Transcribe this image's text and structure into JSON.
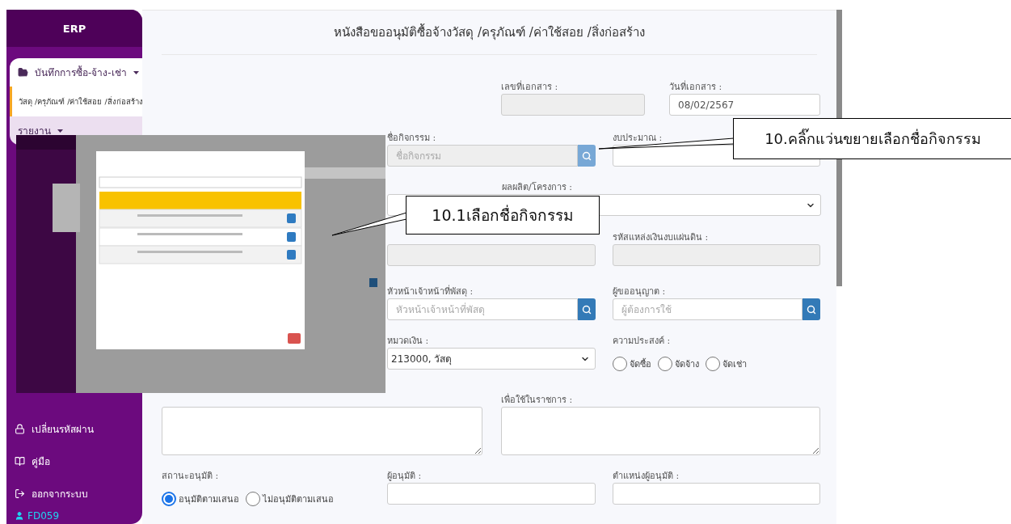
{
  "sidebar": {
    "brand": "ERP",
    "menu": [
      {
        "kind": "group",
        "label": "บันทึกการซื้อ-จ้าง-เช่า",
        "expanded": true
      },
      {
        "kind": "link",
        "label": "วัสดุ /ครุภัณฑ์ /ค่าใช้สอย /สิ่งก่อสร้าง",
        "selected": true
      },
      {
        "kind": "group",
        "label": "รายงาน",
        "expanded": false
      }
    ],
    "links": [
      {
        "label": "เปลี่ยนรหัสผ่าน"
      },
      {
        "label": "คู่มือ"
      },
      {
        "label": "ออกจากระบบ"
      }
    ],
    "user": "FD059"
  },
  "form": {
    "title": "หนังสือขออนุมัติซื้อจ้างวัสดุ /ครุภัณฑ์ /ค่าใช้สอย /สิ่งก่อสร้าง",
    "rows": [
      {
        "fields": [
          {
            "kind": "text",
            "label": "เลขที่เอกสาร :",
            "disabled": true
          },
          {
            "kind": "text",
            "label": "วันที่เอกสาร :",
            "value": "08/02/2567",
            "disabled": false
          }
        ]
      },
      {
        "fields": [
          {
            "kind": "search",
            "label": "ชื่อกิจกรรม :",
            "placeholder": "ชื่อกิจกรรม",
            "disabled": true
          },
          {
            "kind": "text",
            "label": "งบประมาณ :",
            "disabled": false
          }
        ]
      },
      {
        "fields": [
          {
            "kind": "select",
            "label": "ผลผลิต/โครงการ :"
          }
        ]
      },
      {
        "fields": [
          {
            "kind": "text",
            "disabled": true
          },
          {
            "kind": "text",
            "label": "รหัสแหล่งเงินงบแผ่นดิน :",
            "disabled": true
          }
        ]
      },
      {
        "fields": [
          {
            "kind": "search",
            "label": "หัวหน้าเจ้าหน้าที่พัสดุ :",
            "placeholder": "หัวหน้าเจ้าหน้าที่พัสดุ",
            "disabled": false
          },
          {
            "kind": "search",
            "label": "ผู้ขออนุญาต :",
            "placeholder": "ผู้ต้องการใช้",
            "disabled": false
          }
        ]
      },
      {
        "fields": [
          {
            "kind": "select",
            "label": "หมวดเงิน :",
            "value": "213000, วัสดุ"
          },
          {
            "kind": "radios",
            "label": "ความประสงค์ :",
            "options": [
              {
                "label": "จัดซื้อ",
                "selected": false
              },
              {
                "label": "จัดจ้าง",
                "selected": false
              },
              {
                "label": "จัดเช่า",
                "selected": false
              }
            ]
          }
        ]
      },
      {
        "fields": [
          {
            "kind": "textarea"
          },
          {
            "kind": "textarea",
            "label": "เพื่อใช้ในราชการ :"
          }
        ]
      },
      {
        "fields": [
          {
            "kind": "radios",
            "label": "สถานะอนุมัติ :",
            "options": [
              {
                "label": "อนุมัติตามเสนอ",
                "selected": true
              },
              {
                "label": "ไม่อนุมัติตามเสนอ",
                "selected": false
              }
            ]
          },
          {
            "kind": "text",
            "label": "ผู้อนุมัติ :",
            "disabled": false
          },
          {
            "kind": "text",
            "label": "ตำแหน่งผู้อนุมัติ :",
            "disabled": false
          }
        ]
      }
    ]
  },
  "callouts": [
    {
      "text": "10.คลิ๊กแว่นขยายเลือกชื่อกิจกรรม"
    },
    {
      "text": "10.1เลือกชื่อกิจกรรม"
    }
  ]
}
